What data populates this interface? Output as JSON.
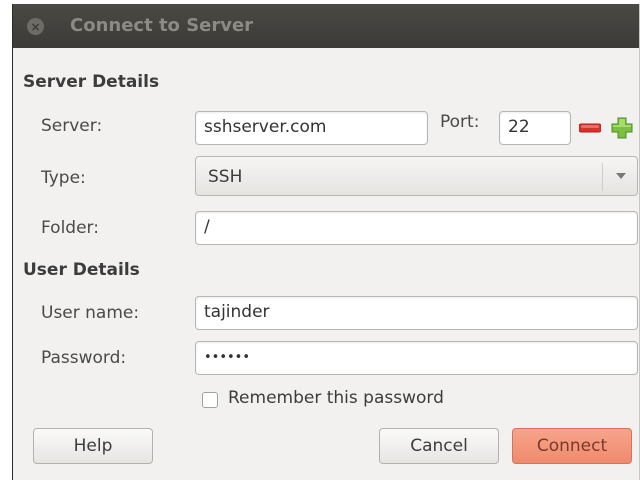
{
  "window": {
    "title": "Connect to Server",
    "close_glyph": "×"
  },
  "server_details": {
    "heading": "Server Details",
    "server_label": "Server:",
    "server_value": "sshserver.com",
    "port_label": "Port:",
    "port_value": "22",
    "port_decrement_icon": "minus-icon",
    "port_increment_icon": "plus-icon",
    "type_label": "Type:",
    "type_value": "SSH",
    "folder_label": "Folder:",
    "folder_value": "/"
  },
  "user_details": {
    "heading": "User Details",
    "username_label": "User name:",
    "username_value": "tajinder",
    "password_label": "Password:",
    "password_value": "••••••",
    "remember_label": "Remember this password",
    "remember_checked": false
  },
  "buttons": {
    "help": "Help",
    "cancel": "Cancel",
    "connect": "Connect"
  },
  "colors": {
    "titlebar": "#3c3b37",
    "accent_button": "#f08a6c",
    "minus_red": "#d9302b",
    "plus_green": "#7bc043"
  }
}
